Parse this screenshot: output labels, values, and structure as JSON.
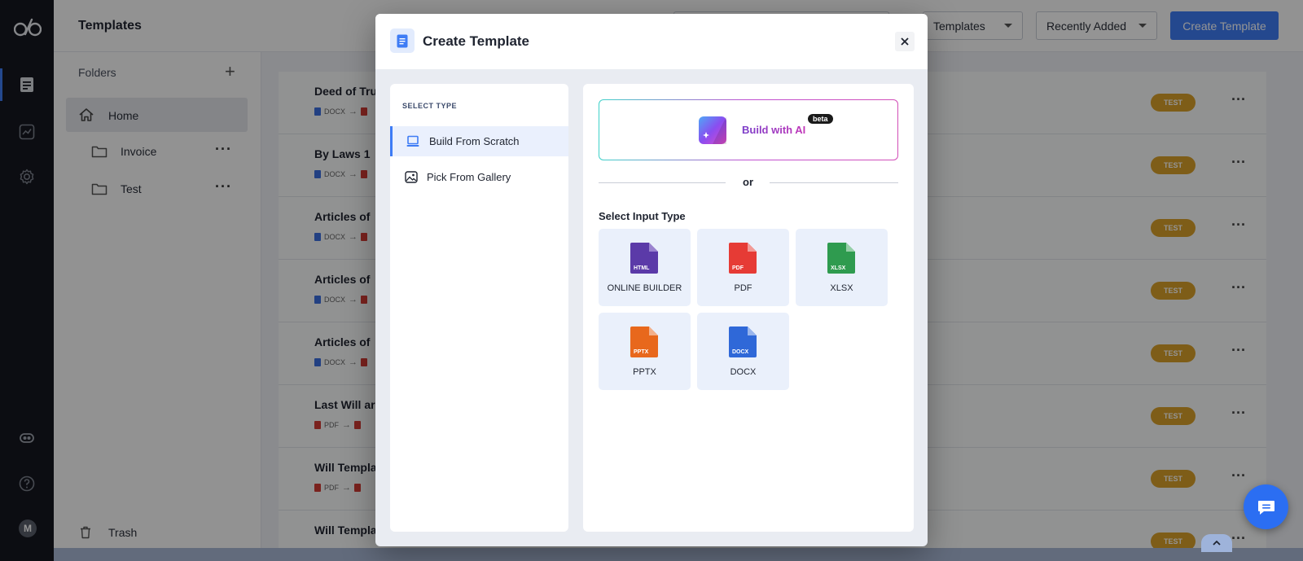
{
  "page": {
    "title": "Templates",
    "filter_label": "Templates",
    "sort_label": "Recently Added",
    "create_label": "Create Template"
  },
  "sidebar": {
    "folders_label": "Folders",
    "home_label": "Home",
    "items": [
      {
        "label": "Invoice"
      },
      {
        "label": "Test"
      }
    ],
    "trash_label": "Trash"
  },
  "rail": {
    "avatar": "M"
  },
  "rows": [
    {
      "title": "Deed of Tru",
      "from": "DOCX",
      "from_color": "#3b6fe0",
      "to_color": "#d23b34",
      "badge": "TEST"
    },
    {
      "title": "By Laws 1",
      "from": "DOCX",
      "from_color": "#3b6fe0",
      "to_color": "#d23b34",
      "badge": "TEST"
    },
    {
      "title": "Articles of",
      "from": "DOCX",
      "from_color": "#3b6fe0",
      "to_color": "#d23b34",
      "badge": "TEST"
    },
    {
      "title": "Articles of",
      "from": "DOCX",
      "from_color": "#3b6fe0",
      "to_color": "#d23b34",
      "badge": "TEST"
    },
    {
      "title": "Articles of",
      "from": "DOCX",
      "from_color": "#3b6fe0",
      "to_color": "#d23b34",
      "badge": "TEST"
    },
    {
      "title": "Last Will ar",
      "from": "PDF",
      "from_color": "#d23b34",
      "to_color": "#d23b34",
      "badge": "TEST"
    },
    {
      "title": "Will Templa",
      "from": "PDF",
      "from_color": "#d23b34",
      "to_color": "#d23b34",
      "badge": "TEST"
    },
    {
      "title": "Will Templa",
      "from": "",
      "from_color": "#d23b34",
      "to_color": "#d23b34",
      "badge": "TEST"
    }
  ],
  "modal": {
    "title": "Create Template",
    "select_type_label": "SELECT TYPE",
    "options": [
      {
        "label": "Build From Scratch",
        "active": true
      },
      {
        "label": "Pick From Gallery",
        "active": false
      }
    ],
    "ai_label": "Build with AI",
    "beta_label": "beta",
    "or_label": "or",
    "select_input_label": "Select Input Type",
    "tiles": [
      {
        "label": "ONLINE BUILDER",
        "badge": "HTML",
        "color": "#5b3aa8",
        "fold": "#9a82cf"
      },
      {
        "label": "PDF",
        "badge": "PDF",
        "color": "#e63b35",
        "fold": "#f29a96"
      },
      {
        "label": "XLSX",
        "badge": "XLSX",
        "color": "#2f9b4f",
        "fold": "#96d0a7"
      },
      {
        "label": "PPTX",
        "badge": "PPTX",
        "color": "#e8681c",
        "fold": "#f3b08a"
      },
      {
        "label": "DOCX",
        "badge": "DOCX",
        "color": "#2f68d8",
        "fold": "#99b5ec"
      }
    ]
  },
  "colors": {
    "accent": "#3e7cf5",
    "badge": "#d9a12a",
    "rail": "#15181f"
  }
}
